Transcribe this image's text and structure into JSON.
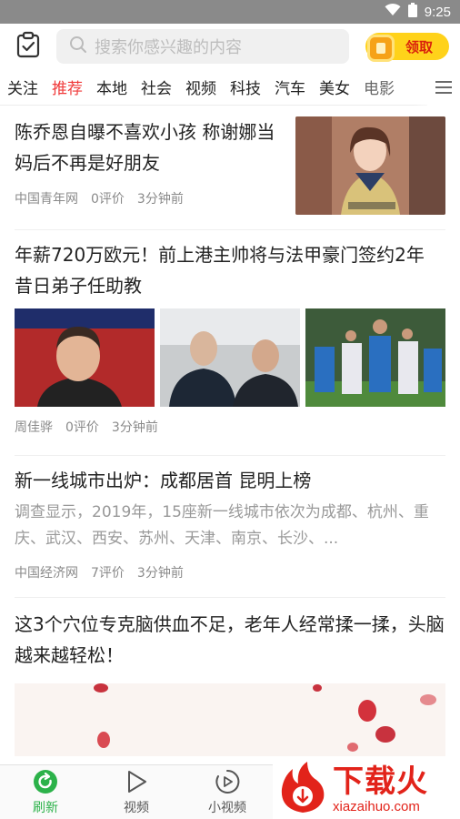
{
  "status_bar": {
    "time": "9:25"
  },
  "header": {
    "search_placeholder": "搜索你感兴趣的内容",
    "reward_label": "领取"
  },
  "tabs": [
    {
      "label": "关注"
    },
    {
      "label": "推荐"
    },
    {
      "label": "本地"
    },
    {
      "label": "社会"
    },
    {
      "label": "视频"
    },
    {
      "label": "科技"
    },
    {
      "label": "汽车"
    },
    {
      "label": "美女"
    },
    {
      "label": "电影"
    }
  ],
  "active_tab": "推荐",
  "articles": [
    {
      "title": "陈乔恩自曝不喜欢小孩 称谢娜当妈后不再是好朋友",
      "source": "中国青年网",
      "comments": "0评价",
      "time": "3分钟前"
    },
    {
      "title": "年薪720万欧元！前上港主帅将与法甲豪门签约2年 昔日弟子任助教",
      "source": "周佳骅",
      "comments": "0评价",
      "time": "3分钟前"
    },
    {
      "title": "新一线城市出炉：成都居首 昆明上榜",
      "summary": "调查显示，2019年，15座新一线城市依次为成都、杭州、重庆、武汉、西安、苏州、天津、南京、长沙、...",
      "source": "中国经济网",
      "comments": "7评价",
      "time": "3分钟前"
    },
    {
      "title": "这3个穴位专克脑供血不足，老年人经常揉一揉，头脑越来越轻松！"
    }
  ],
  "bottom_nav": [
    {
      "label": "刷新",
      "icon": "refresh-icon"
    },
    {
      "label": "视频",
      "icon": "play-icon"
    },
    {
      "label": "小视频",
      "icon": "small-video-icon"
    }
  ],
  "watermark": {
    "cn": "下载火",
    "en": "xiazaihuo.com"
  },
  "colors": {
    "accent_red": "#f03a3a",
    "nav_green": "#2cb24a",
    "reward_yellow": "#ffd21a"
  }
}
